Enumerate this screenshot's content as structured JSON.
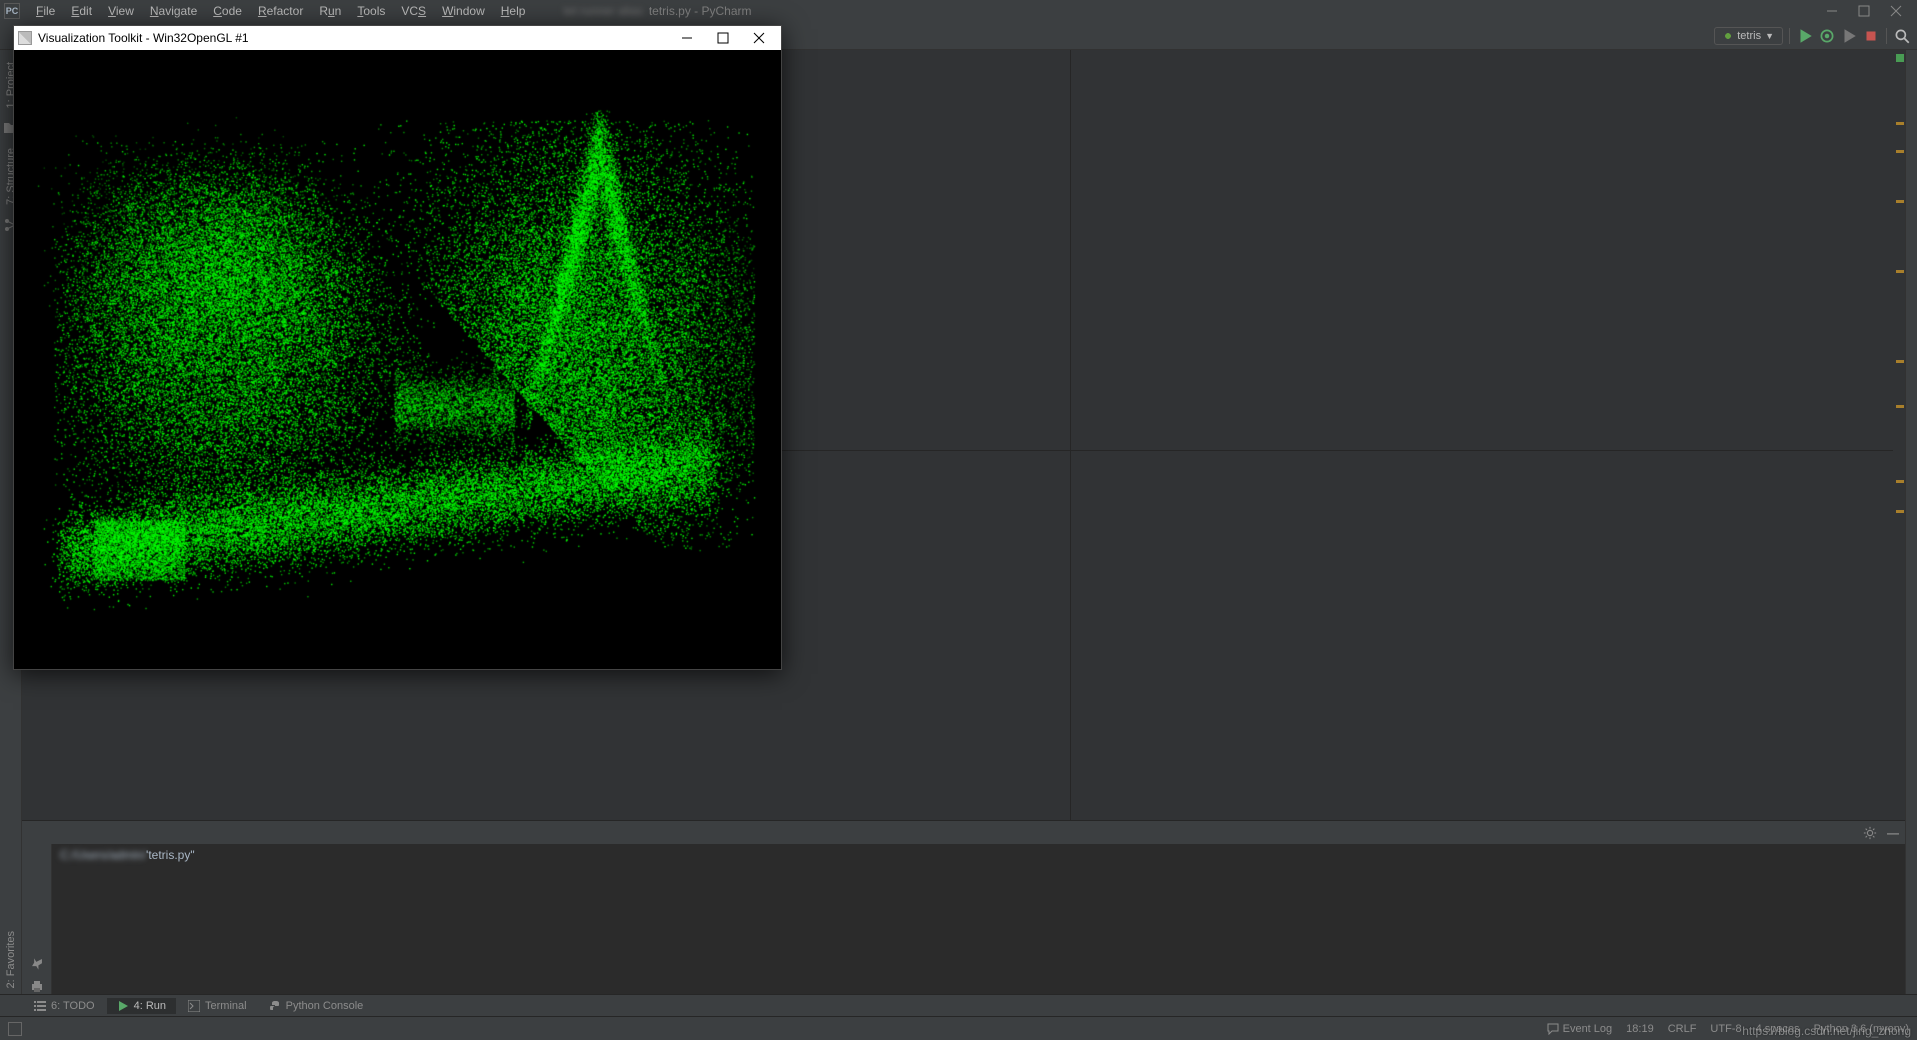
{
  "menu": {
    "items": [
      "File",
      "Edit",
      "View",
      "Navigate",
      "Code",
      "Refactor",
      "Run",
      "Tools",
      "VCS",
      "Window",
      "Help"
    ],
    "underlines": [
      "F",
      "E",
      "V",
      "N",
      "C",
      "R",
      "u",
      "T",
      "S",
      "W",
      "H"
    ],
    "title_blur": "tet runner alias",
    "title_file": "tetris.py - PyCharm"
  },
  "toolbar": {
    "run_config_label": "tetris",
    "icons": {
      "run": "▶",
      "debug": "◉",
      "coverage": "◑",
      "stop": "■",
      "search": "🔍"
    }
  },
  "left_tabs": {
    "project": "1: Project",
    "structure": "7: Structure",
    "favorites": "2: Favorites"
  },
  "run_panel": {
    "output_blur": "C:/Users/admin/",
    "output_rest": "'tetris.py\""
  },
  "bottom": {
    "todo": "6: TODO",
    "run": "4: Run",
    "terminal": "Terminal",
    "pyconsole": "Python Console"
  },
  "status": {
    "event_log": "Event Log",
    "pos": "18:19",
    "eol": "CRLF",
    "enc": "UTF-8",
    "indent": "4 spaces",
    "interp": "Python 3.6 (myenv)"
  },
  "vtk": {
    "title": "Visualization Toolkit - Win32OpenGL #1"
  },
  "marker_positions": [
    72,
    100,
    150,
    220,
    310,
    355,
    430,
    480
  ],
  "watermark": "https://blog.csdn.net/jing_zhong"
}
